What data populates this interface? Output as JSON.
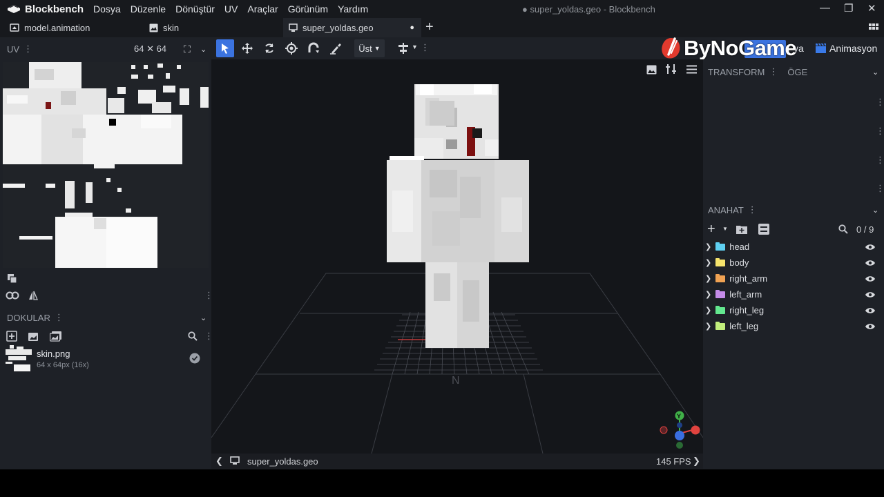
{
  "app": {
    "name": "Blockbench",
    "window_title": "● super_yoldas.geo - Blockbench"
  },
  "menu": [
    "Dosya",
    "Düzenle",
    "Dönüştür",
    "UV",
    "Araçlar",
    "Görünüm",
    "Yardım"
  ],
  "tabs": [
    {
      "label": "model.animation",
      "active": false
    },
    {
      "label": "skin",
      "active": false
    },
    {
      "label": "super_yoldas.geo",
      "active": true,
      "modified_marker": "●"
    }
  ],
  "uv_panel": {
    "title": "UV",
    "resolution": "64 ✕ 64"
  },
  "toolbar": {
    "view_select": "Üst"
  },
  "modes": {
    "edit_label": "e",
    "paint_label": "ya",
    "animate_label": "Animasyon"
  },
  "watermark": {
    "text": "ByNoGame"
  },
  "textures": {
    "title": "DOKULAR",
    "items": [
      {
        "name": "skin.png",
        "info": "64 x 64px (16x)"
      }
    ]
  },
  "transform_panel": {
    "tab1": "TRANSFORM",
    "tab2": "ÖGE"
  },
  "outliner": {
    "title": "ANAHAT",
    "count": "0 / 9",
    "groups": [
      {
        "name": "head",
        "color": "#5fd0f2"
      },
      {
        "name": "body",
        "color": "#f5e36c"
      },
      {
        "name": "right_arm",
        "color": "#f0a253"
      },
      {
        "name": "left_arm",
        "color": "#c48be8"
      },
      {
        "name": "right_leg",
        "color": "#63e88f"
      },
      {
        "name": "left_leg",
        "color": "#c2ef7c"
      }
    ]
  },
  "statusbar": {
    "file": "super_yoldas.geo",
    "fps": "145 FPS"
  },
  "gizmo": {
    "up_label": "Y",
    "x_color": "#e0433f",
    "y_color": "#40b048",
    "z_color": "#3a6ee0"
  }
}
